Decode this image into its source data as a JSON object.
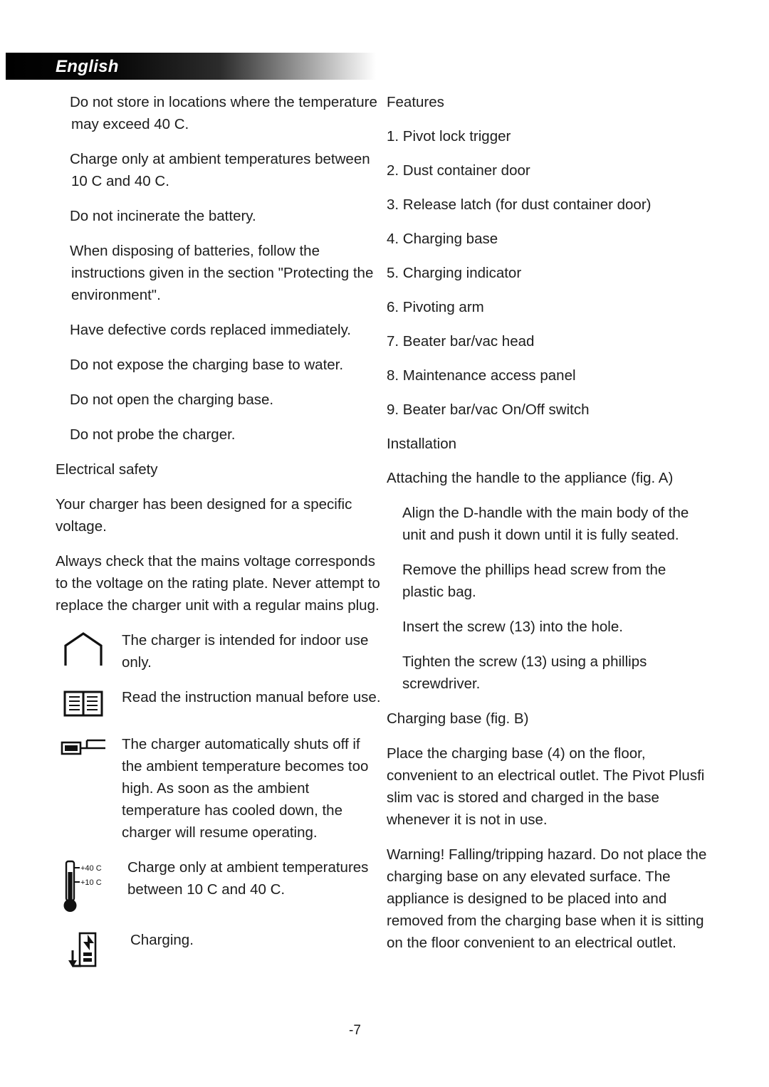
{
  "header": {
    "language_label": "English"
  },
  "left_column": {
    "paragraphs": [
      "Do not store in locations where the temperature may exceed 40 C.",
      "Charge only at ambient temperatures between 10 C and 40 C.",
      "Do not incinerate the battery.",
      "When disposing of batteries, follow the instructions given in the section \"Protecting the environment\".",
      "Have defective cords replaced immediately.",
      "Do not expose the charging base to water.",
      "Do not open the charging base.",
      "Do not probe the charger."
    ],
    "section_heading": "Electrical safety",
    "safety_paragraphs": [
      "Your charger has been designed for a specific voltage.",
      "Always check that the mains voltage corresponds to the voltage on the rating plate. Never attempt to replace the charger unit with a regular mains plug."
    ],
    "icon_items": [
      {
        "icon": "house-icon",
        "text": "The charger is intended for indoor use only."
      },
      {
        "icon": "open-book-icon",
        "text": "Read the instruction manual before use."
      },
      {
        "icon": "thermal-cutout-icon",
        "text": "The charger automatically shuts off if the ambient temperature becomes too high. As soon as the ambient temperature has cooled down, the charger will resume operating."
      },
      {
        "icon": "thermometer-icon",
        "text": "Charge only at ambient temperatures between 10 C and 40 C.",
        "labels": [
          "+40 C",
          "+10 C"
        ]
      },
      {
        "icon": "charging-battery-icon",
        "text": "Charging."
      }
    ]
  },
  "right_column": {
    "features_heading": "Features",
    "features": [
      "1. Pivot lock trigger",
      "2. Dust container door",
      "3. Release latch (for dust container door)",
      "4. Charging base",
      "5. Charging indicator",
      "6. Pivoting arm",
      "7. Beater bar/vac head",
      "8. Maintenance access panel",
      "9. Beater bar/vac On/Off switch"
    ],
    "installation_heading": "Installation",
    "installation_subheading": "Attaching the handle to the appliance (fig. A)",
    "installation_steps": [
      "Align the D-handle with the main body of the unit and push it down until it is fully seated.",
      "Remove the phillips head screw from the plastic bag.",
      "Insert the screw (13) into the hole.",
      "Tighten the screw (13) using a phillips screwdriver."
    ],
    "charging_base_heading": "Charging base (fig. B)",
    "charging_base_paragraphs": [
      "Place the charging base (4) on the floor, convenient to an electrical outlet. The Pivot Plusfi slim vac is stored and charged in the base whenever it is not in use.",
      "Warning! Falling/tripping hazard. Do not place the charging base on any elevated surface. The appliance is designed to be placed into and removed from the charging base when it is sitting on the floor convenient to an electrical outlet."
    ]
  },
  "footer": {
    "page_number": "-7"
  }
}
